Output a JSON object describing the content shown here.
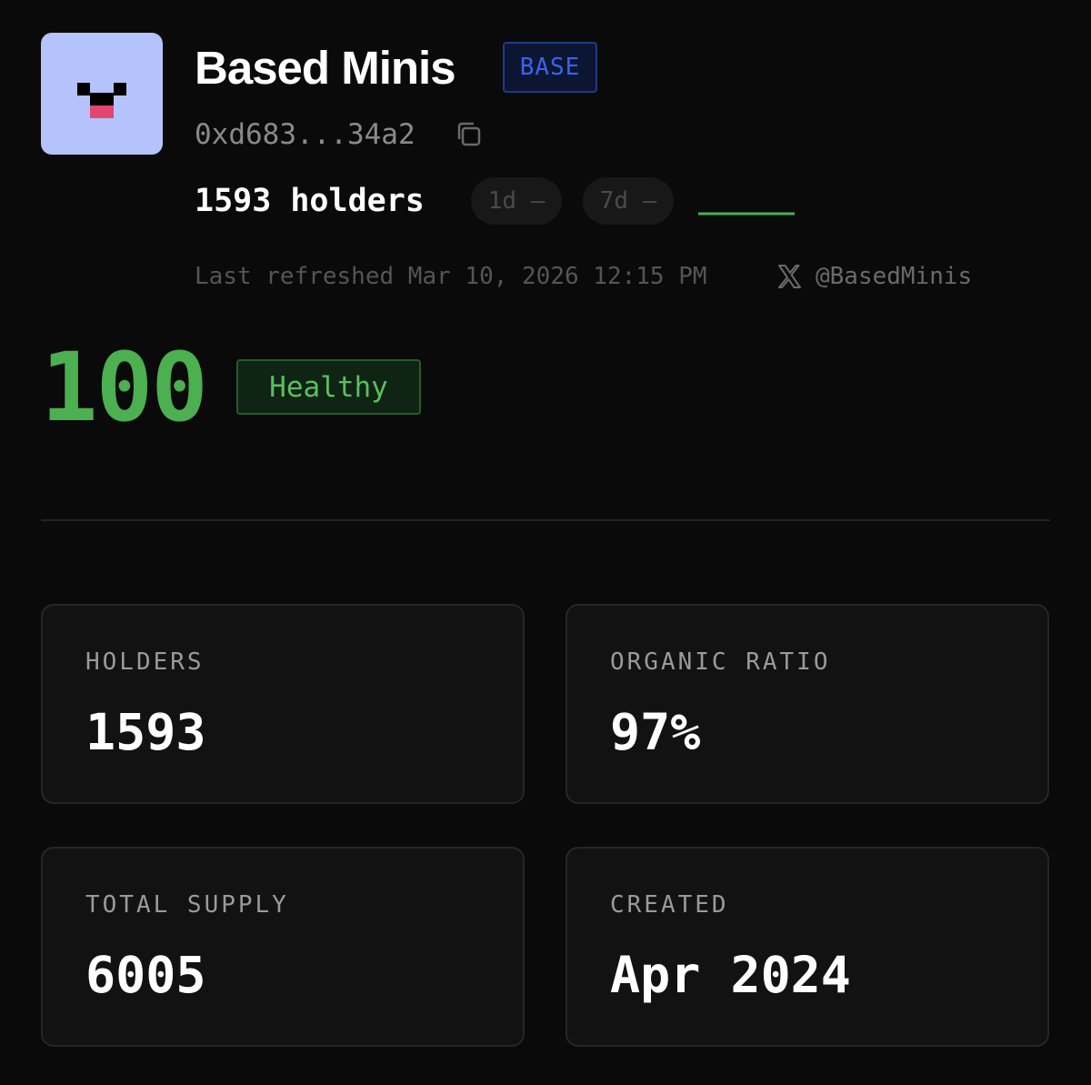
{
  "collection": {
    "name": "Based Minis",
    "chain": "BASE",
    "address": "0xd683...34a2",
    "avatar_icon": "pixel-face-icon",
    "avatar_bg": "#b4c3fb"
  },
  "holders_summary": {
    "text": "1593 holders",
    "change_1d": "1d —",
    "change_7d": "7d —"
  },
  "meta": {
    "last_refreshed": "Last refreshed Mar 10, 2026 12:15 PM",
    "social_icon": "x-icon",
    "social_handle": "@BasedMinis"
  },
  "health": {
    "score": "100",
    "status": "Healthy",
    "color": "#4caf50"
  },
  "stats": [
    {
      "label": "HOLDERS",
      "value": "1593"
    },
    {
      "label": "ORGANIC RATIO",
      "value": "97%"
    },
    {
      "label": "TOTAL SUPPLY",
      "value": "6005"
    },
    {
      "label": "CREATED",
      "value": "Apr 2024"
    }
  ],
  "colors": {
    "background": "#0a0a0a",
    "chain_badge": "#3b63ea",
    "sparkline": "#4caf50"
  }
}
